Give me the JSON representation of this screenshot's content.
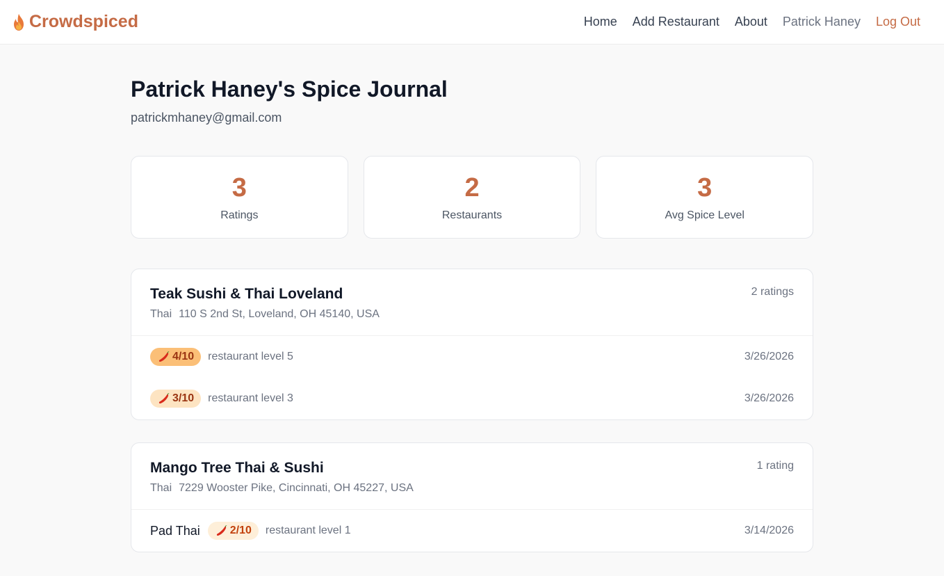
{
  "navbar": {
    "brand": "Crowdspiced",
    "links": [
      {
        "label": "Home"
      },
      {
        "label": "Add Restaurant"
      },
      {
        "label": "About"
      }
    ],
    "user_name": "Patrick Haney",
    "logout": "Log Out"
  },
  "profile": {
    "title": "Patrick Haney's Spice Journal",
    "email": "patrickmhaney@gmail.com"
  },
  "stats": [
    {
      "value": "3",
      "label": "Ratings"
    },
    {
      "value": "2",
      "label": "Restaurants"
    },
    {
      "value": "3",
      "label": "Avg Spice Level"
    }
  ],
  "restaurants": [
    {
      "name": "Teak Sushi & Thai Loveland",
      "cuisine": "Thai",
      "address": "110 S 2nd St, Loveland, OH 45140, USA",
      "count": "2 ratings",
      "ratings": [
        {
          "dish": "",
          "badge": "4/10",
          "note": "restaurant level 5",
          "date": "3/26/2026"
        },
        {
          "dish": "",
          "badge": "3/10",
          "note": "restaurant level 3",
          "date": "3/26/2026"
        }
      ]
    },
    {
      "name": "Mango Tree Thai & Sushi",
      "cuisine": "Thai",
      "address": "7229 Wooster Pike, Cincinnati, OH 45227, USA",
      "count": "1 rating",
      "ratings": [
        {
          "dish": "Pad Thai",
          "badge": "2/10",
          "note": "restaurant level 1",
          "date": "3/14/2026"
        }
      ]
    }
  ],
  "colors": {
    "accent": "#c56b45",
    "badge_strong": "#fbbf77",
    "badge_mid": "#fde4c2",
    "badge_light": "#feefd9"
  },
  "icons": {
    "brand": "flame-icon",
    "badge": "chili-pepper-icon"
  }
}
